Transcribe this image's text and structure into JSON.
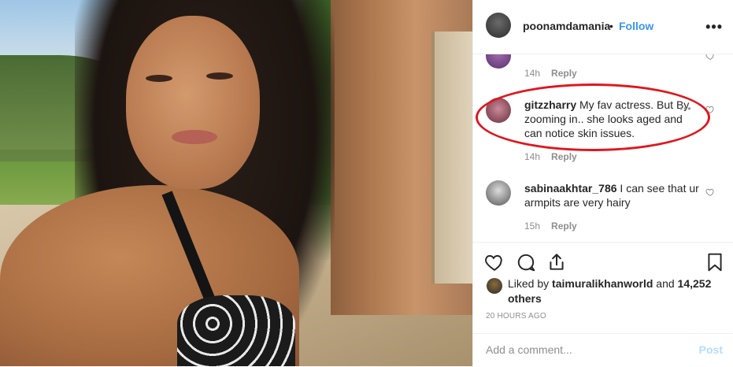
{
  "header": {
    "username": "poonamdamania",
    "separator": "•",
    "follow_label": "Follow",
    "more_icon": "more-options-icon"
  },
  "comments": [
    {
      "username": "",
      "text": "",
      "time": "14h",
      "reply_label": "Reply"
    },
    {
      "username": "gitzzharry",
      "text": "My fav actress. But By zooming in.. she looks aged and can notice skin issues.",
      "time": "14h",
      "reply_label": "Reply"
    },
    {
      "username": "sabinaakhtar_786",
      "text": "I can see that ur armpits are very hairy",
      "time": "15h",
      "reply_label": "Reply"
    }
  ],
  "likes": {
    "prefix": "Liked by",
    "user": "taimuralikhanworld",
    "connector": "and",
    "count_text": "14,252 others"
  },
  "timestamp": "20 HOURS AGO",
  "add_comment": {
    "placeholder": "Add a comment...",
    "post_label": "Post"
  },
  "colors": {
    "link_blue": "#3897f0",
    "post_disabled": "#b2dffc",
    "highlight_ellipse": "#e0161e"
  }
}
